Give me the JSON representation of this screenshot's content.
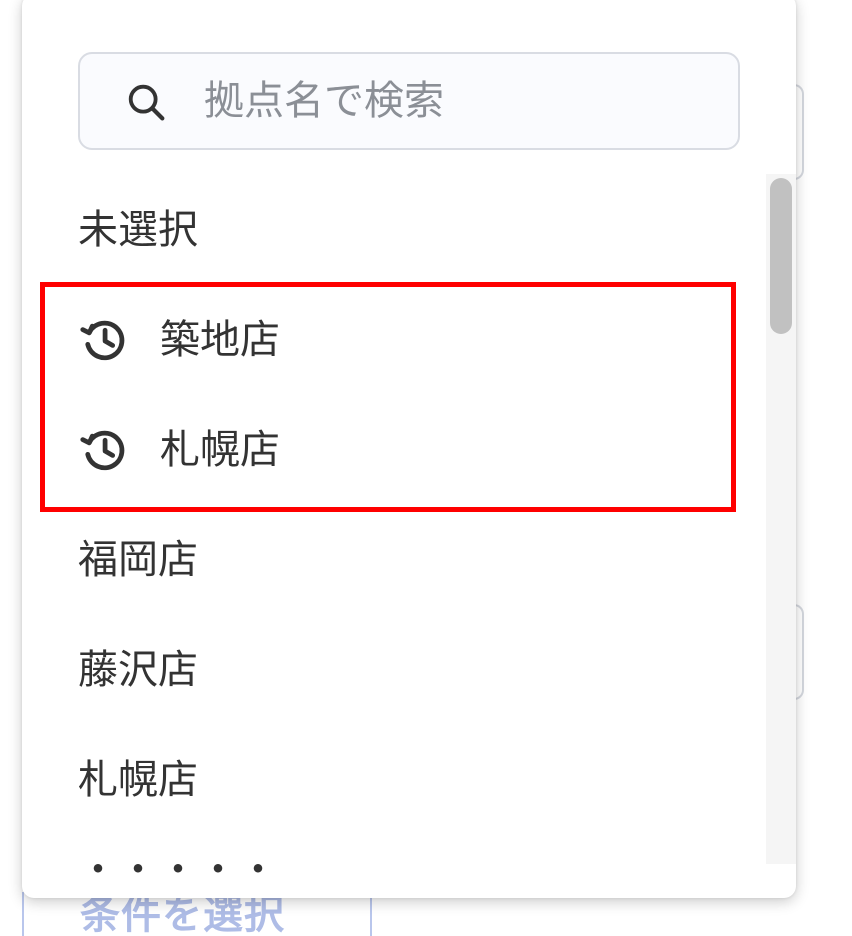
{
  "background": {
    "condition_button_label": "条件を選択"
  },
  "dropdown": {
    "search": {
      "placeholder": "拠点名で検索",
      "value": "",
      "icon": "search-icon"
    },
    "options": [
      {
        "label": "未選択",
        "type": "plain"
      },
      {
        "label": "築地店",
        "type": "history",
        "icon": "history-icon"
      },
      {
        "label": "札幌店",
        "type": "history",
        "icon": "history-icon"
      },
      {
        "label": "福岡店",
        "type": "plain"
      },
      {
        "label": "藤沢店",
        "type": "plain"
      },
      {
        "label": "札幌店",
        "type": "plain"
      }
    ],
    "partial_option": "・・・・・"
  },
  "colors": {
    "highlight": "#ff0000",
    "text": "#333333",
    "placeholder": "#8b8f96",
    "condition_text": "#aebce6"
  }
}
